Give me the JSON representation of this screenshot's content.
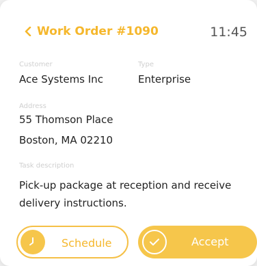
{
  "header": {
    "title": "Work Order #1090",
    "time": "11:45"
  },
  "fields": {
    "customer_label": "Customer",
    "customer_value": "Ace Systems Inc",
    "type_label": "Type",
    "type_value": "Enterprise",
    "address_label": "Address",
    "address_line1": "55 Thomson Place",
    "address_line2": "Boston, MA 02210",
    "task_label": "Task description",
    "task_line1": "Pick-up package at reception and receive",
    "task_line2": "delivery instructions."
  },
  "actions": {
    "schedule_label": "Schedule",
    "accept_label": "Accept"
  },
  "icons": {
    "back": "chevron-left-icon",
    "schedule": "clock-icon",
    "accept": "check-circle-icon"
  },
  "colors": {
    "accent": "#f5b72c",
    "accept_bg": "#f6c64b"
  }
}
